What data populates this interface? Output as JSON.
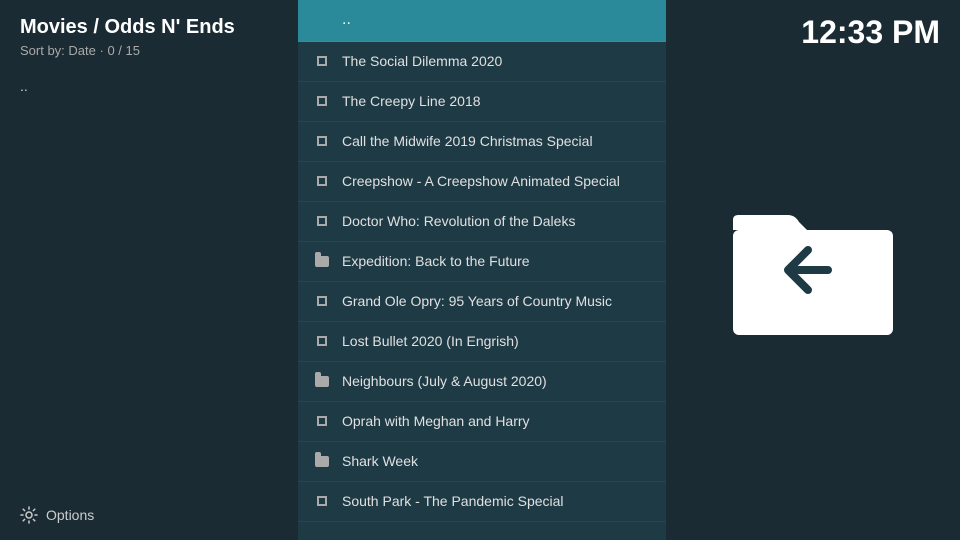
{
  "sidebar": {
    "title": "Movies / Odds N' Ends",
    "sort_label": "Sort by: Date",
    "count": "0 / 15",
    "back_label": "..",
    "options_label": "Options",
    "settings_icon": "gear-icon"
  },
  "clock": {
    "time": "12:33 PM"
  },
  "list": {
    "parent_item": "..",
    "items": [
      {
        "id": 1,
        "label": "The Social Dilemma 2020",
        "type": "file"
      },
      {
        "id": 2,
        "label": "The Creepy Line 2018",
        "type": "file"
      },
      {
        "id": 3,
        "label": "Call the Midwife 2019 Christmas Special",
        "type": "file"
      },
      {
        "id": 4,
        "label": "Creepshow - A Creepshow Animated Special",
        "type": "file"
      },
      {
        "id": 5,
        "label": "Doctor Who: Revolution of the Daleks",
        "type": "file"
      },
      {
        "id": 6,
        "label": "Expedition: Back to the Future",
        "type": "folder"
      },
      {
        "id": 7,
        "label": "Grand Ole Opry: 95 Years of Country Music",
        "type": "file"
      },
      {
        "id": 8,
        "label": "Lost Bullet 2020 (In Engrish)",
        "type": "file"
      },
      {
        "id": 9,
        "label": "Neighbours (July & August 2020)",
        "type": "folder"
      },
      {
        "id": 10,
        "label": "Oprah with Meghan and Harry",
        "type": "file"
      },
      {
        "id": 11,
        "label": "Shark Week",
        "type": "folder"
      },
      {
        "id": 12,
        "label": "South Park - The Pandemic Special",
        "type": "file"
      }
    ]
  },
  "right_panel": {
    "folder_icon": "folder-back-icon"
  }
}
